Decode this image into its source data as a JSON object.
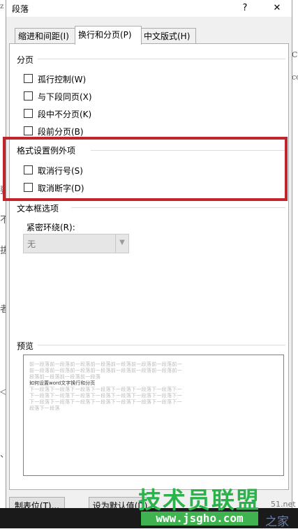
{
  "background_doc": {
    "left_fragments": [
      "z",
      "要",
      "不",
      "拔",
      "者",
      "◁",
      "、"
    ],
    "right_fragments": [
      "Co",
      "co"
    ]
  },
  "dialog": {
    "title": "段落",
    "help_btn": "?",
    "close_btn": "✕",
    "tabs": [
      {
        "label": "缩进和间距(I)",
        "active": false
      },
      {
        "label": "换行和分页(P)",
        "active": true
      },
      {
        "label": "中文版式(H)",
        "active": false
      }
    ],
    "pagination": {
      "title": "分页",
      "options": [
        {
          "label": "孤行控制(W)",
          "checked": false
        },
        {
          "label": "与下段同页(X)",
          "checked": false
        },
        {
          "label": "段中不分页(K)",
          "checked": false
        },
        {
          "label": "段前分页(B)",
          "checked": false
        }
      ]
    },
    "exceptions": {
      "title": "格式设置例外项",
      "options": [
        {
          "label": "取消行号(S)",
          "checked": false
        },
        {
          "label": "取消断字(D)",
          "checked": false
        }
      ]
    },
    "textbox": {
      "title": "文本框选项",
      "wrap_label": "紧密环绕(R):",
      "wrap_value": "无"
    },
    "preview": {
      "title": "预览",
      "prev_para": "前一段落前一段落前一段落前一段落前一段落前一段落前一段落前一",
      "prev_para_end": "段落前一段落前一段落前一段落",
      "sample": "如何设置word文字换行和分页",
      "next_para": "下一段落下一段落下一段落下一段落下一段落下一段落下一段落下一",
      "next_para_end": "段落下一段落"
    },
    "buttons": {
      "tabs": "制表位(T)...",
      "set_default": "设为默认值(D)"
    }
  },
  "watermark": {
    "brand": "技术员联盟",
    "url": "www.jsgho.com",
    "domain_fragment": "51.net",
    "site_suffix": "之家"
  },
  "colors": {
    "highlight": "#c4232b",
    "watermark_green": "#29b34a"
  }
}
